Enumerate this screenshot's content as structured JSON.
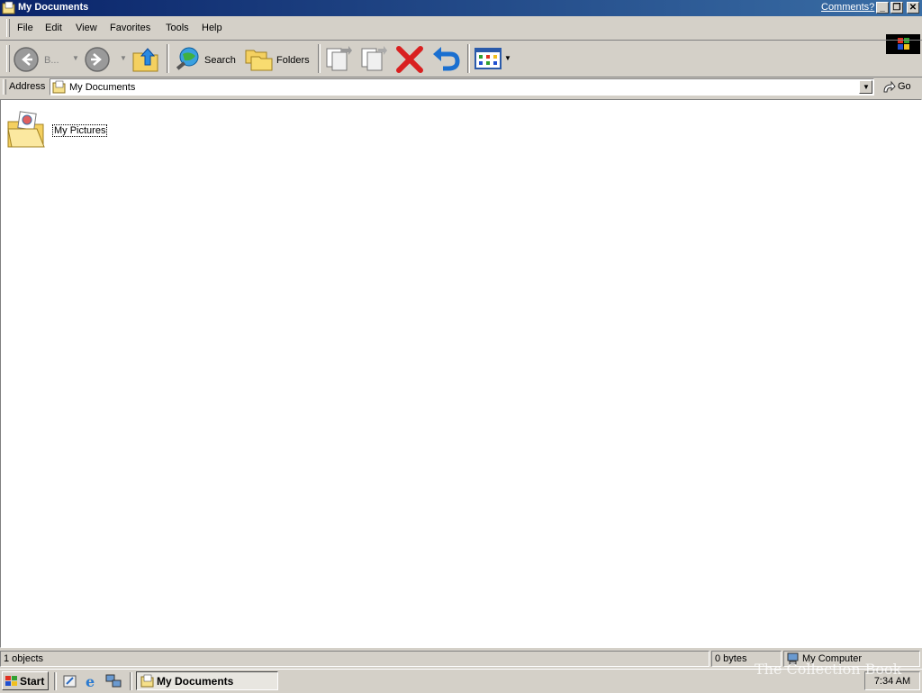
{
  "window": {
    "title": "My Documents",
    "comments_link": "Comments?",
    "caption_buttons": [
      "minimize",
      "restore",
      "close"
    ]
  },
  "menubar": {
    "items": [
      {
        "label": "File"
      },
      {
        "label": "Edit"
      },
      {
        "label": "View"
      },
      {
        "label": "Favorites"
      },
      {
        "label": "Tools"
      },
      {
        "label": "Help"
      }
    ]
  },
  "toolbar": {
    "back_label": "B...",
    "search_label": "Search",
    "folders_label": "Folders",
    "icons": [
      "back-arrow-icon",
      "forward-arrow-icon",
      "folder-up-icon",
      "search-globe-icon",
      "folders-icon",
      "move-to-icon",
      "copy-to-icon",
      "delete-x-icon",
      "undo-icon",
      "views-icon"
    ]
  },
  "addressbar": {
    "label": "Address",
    "value": "My Documents",
    "go_label": "Go"
  },
  "content": {
    "items": [
      {
        "label": "My Pictures",
        "icon": "my-pictures-folder-icon"
      }
    ]
  },
  "statusbar": {
    "objects": "1 objects",
    "size": "0 bytes",
    "location": "My Computer"
  },
  "taskbar": {
    "start_label": "Start",
    "task_label": "My Documents",
    "clock": "7:34 AM"
  },
  "watermark": "The Collection Book",
  "colors": {
    "titlebar_start": "#0a246a",
    "titlebar_end": "#3a6ea5",
    "face": "#d4d0c8",
    "delete_red": "#d92020",
    "undo_blue": "#1a6fd0"
  }
}
